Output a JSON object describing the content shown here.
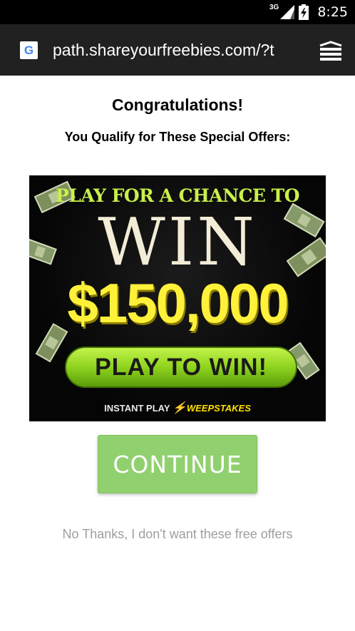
{
  "status_bar": {
    "network_label": "3G",
    "time": "8:25",
    "icons": [
      "signal-icon",
      "battery-charging-icon"
    ]
  },
  "browser": {
    "site_icon": "google-g-icon",
    "site_icon_letter": "G",
    "url": "path.shareyourfreebies.com/?t",
    "menu_icon": "tabs-stack-icon"
  },
  "page": {
    "title": "Congratulations!",
    "subtitle": "You Qualify for These Special Offers:",
    "banner": {
      "line1": "PLAY FOR A CHANCE TO",
      "line2": "WIN",
      "amount": "$150,000",
      "button": "PLAY TO WIN!",
      "brand_prefix": "INSTANT PLAY",
      "brand_name": "WEEPSTAKES",
      "decoration_icon": "dollar-bill-icon"
    },
    "continue_button": "CONTINUE",
    "decline_link": "No Thanks, I don't want these free offers"
  },
  "colors": {
    "status_bar": "#000000",
    "address_bar": "#212121",
    "continue_button": "#91d06f",
    "decline_text": "#9e9e9e",
    "banner_green": "#c9f04a",
    "banner_yellow": "#fff13a"
  }
}
